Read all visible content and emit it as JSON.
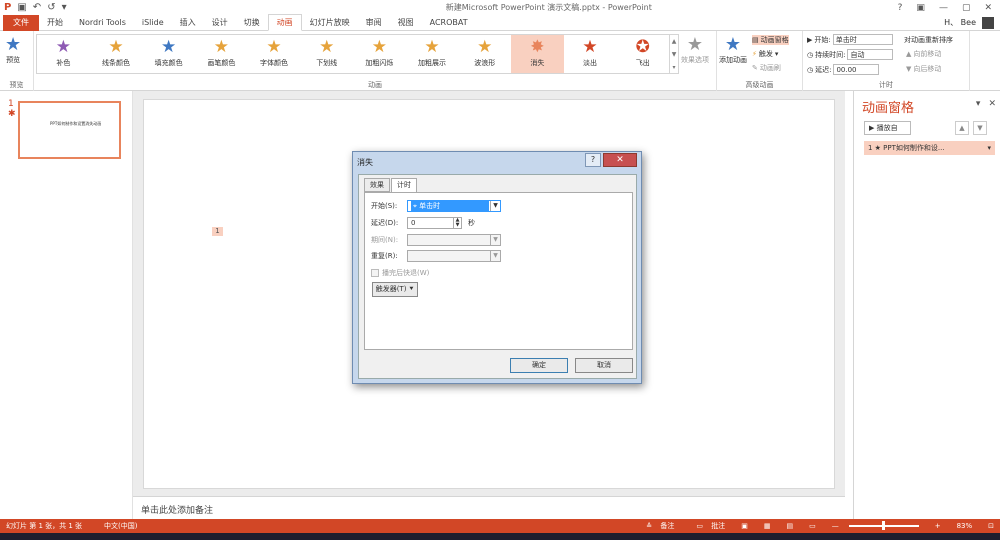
{
  "window": {
    "title": "新建Microsoft PowerPoint 演示文稿.pptx - PowerPoint",
    "controls": [
      "?",
      "▣",
      "—",
      "▢",
      "✕"
    ]
  },
  "qat": {
    "undo": "↶",
    "redo": "↺"
  },
  "tabs": [
    "文件",
    "开始",
    "Nordri Tools",
    "iSlide",
    "插入",
    "设计",
    "切换",
    "动画",
    "幻灯片放映",
    "审阅",
    "视图",
    "ACROBAT"
  ],
  "active_tab": "动画",
  "user": {
    "name": "H、 Bee"
  },
  "ribbon": {
    "preview": {
      "label": "预览",
      "group": "预览"
    },
    "effects": [
      {
        "label": "补色",
        "color": "#8e5ab4"
      },
      {
        "label": "线条颜色",
        "color": "#e6a33b"
      },
      {
        "label": "填充颜色",
        "color": "#3f78c2"
      },
      {
        "label": "画笔颜色",
        "color": "#e6a33b"
      },
      {
        "label": "字体颜色",
        "color": "#e6a33b"
      },
      {
        "label": "下划线",
        "color": "#e6a33b"
      },
      {
        "label": "加粗闪烁",
        "color": "#e6a33b"
      },
      {
        "label": "加粗展示",
        "color": "#e6a33b"
      },
      {
        "label": "波浪形",
        "color": "#e6a33b"
      },
      {
        "label": "消失",
        "color": "#e8845c"
      },
      {
        "label": "淡出",
        "color": "#d24726"
      },
      {
        "label": "飞出",
        "color": "#d24726"
      }
    ],
    "effect_options": "效果选项",
    "animation_group": "动画",
    "add_animation": "添加动画",
    "animation_pane": "动画窗格",
    "trigger": "触发",
    "painter": "动画刷",
    "advanced_group": "高级动画",
    "start_label": "开始:",
    "start_value": "单击时",
    "duration_label": "持续时间:",
    "duration_value": "自动",
    "delay_label": "延迟:",
    "delay_value": "00.00",
    "reorder": "对动画重新排序",
    "move_earlier": "向前移动",
    "move_later": "向后移动",
    "timing_group": "计时"
  },
  "thumbnail": {
    "number": "1",
    "marker": "✱",
    "text": "PPT如何制作和设置消失动画"
  },
  "slide_tag": "1",
  "notes_placeholder": "单击此处添加备注",
  "anim_pane": {
    "title": "动画窗格",
    "play": "播放自",
    "item": "1 ★ PPT如何制作和设...",
    "up": "▲",
    "down": "▼"
  },
  "dialog": {
    "title": "消失",
    "tabs": [
      "效果",
      "计时"
    ],
    "start_label": "开始(S):",
    "start_value": "单击时",
    "delay_label": "延迟(D):",
    "delay_value": "0",
    "delay_unit": "秒",
    "period_label": "期间(N):",
    "repeat_label": "重复(R):",
    "rewind_label": "播完后快退(W)",
    "trigger_button": "触发器(T) ⯆",
    "ok": "确定",
    "cancel": "取消"
  },
  "status": {
    "slide": "幻灯片 第 1 张，共 1 张",
    "language": "中文(中国)",
    "notes": "备注",
    "comments": "批注",
    "zoom": "83%"
  }
}
